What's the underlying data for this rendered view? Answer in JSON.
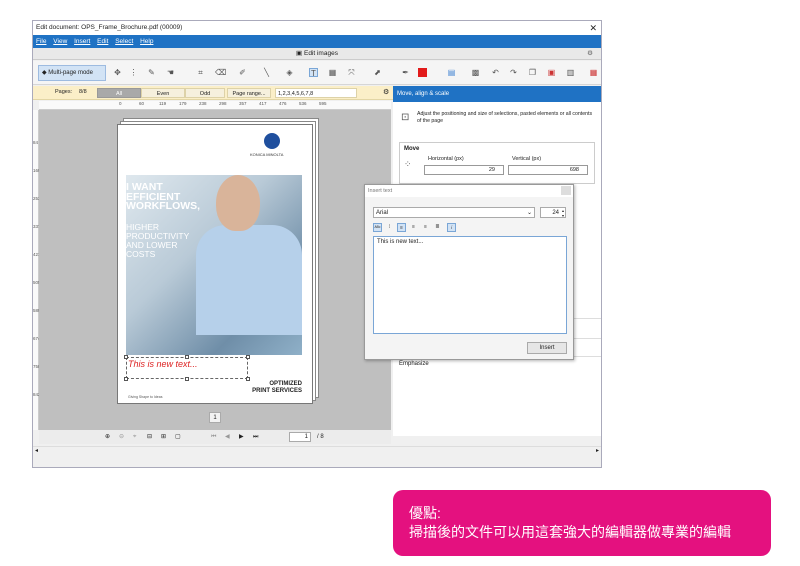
{
  "window": {
    "title": "Edit document: OPS_Frame_Brochure.pdf (00009)",
    "close": "✕"
  },
  "menu": [
    "File",
    "View",
    "Insert",
    "Edit",
    "Select",
    "Help"
  ],
  "ribbon": {
    "title": "Edit images"
  },
  "toolbar": {
    "multipage_label": "Multi-page mode"
  },
  "pages_bar": {
    "label": "Pages:",
    "count": "8/8",
    "all": "All",
    "even": "Even",
    "odd": "Odd",
    "range": "Page range...",
    "range_value": "1,2,3,4,5,6,7,8"
  },
  "ruler": {
    "h_ticks": [
      "0",
      "60",
      "119",
      "179",
      "238",
      "298",
      "357",
      "417",
      "476",
      "536",
      "595"
    ],
    "v_ticks": [
      "84",
      "169",
      "253",
      "337",
      "421",
      "505",
      "589",
      "674",
      "758",
      "842"
    ]
  },
  "brochure": {
    "logo_text": "KONICA MINOLTA",
    "headline": [
      "I WANT",
      "EFFICIENT",
      "WORKFLOWS,"
    ],
    "subline": [
      "HIGHER",
      "PRODUCTIVITY",
      "AND LOWER",
      "COSTS"
    ],
    "new_text": "This is new text...",
    "footer_left": "Giving Shape to Ideas",
    "footer_right": [
      "OPTIMIZED",
      "PRINT SERVICES"
    ]
  },
  "canvas": {
    "page_badge": "1"
  },
  "navigation": {
    "current_page": "1",
    "total": "/ 8"
  },
  "right_panel": {
    "header": "Move, align & scale",
    "description": "Adjust the positioning and size of selections, pasted elements or all contents of the page",
    "move_label": "Move",
    "horizontal_label": "Horizontal (px)",
    "horizontal_value": "29",
    "vertical_label": "Vertical (px)",
    "vertical_value": "698",
    "emphasize": "Emphasize"
  },
  "insert_dialog": {
    "title": "Insert text",
    "font": "Arial",
    "size": "24",
    "text": "This is new text...",
    "insert_button": "Insert"
  },
  "callout": {
    "title": "優點:",
    "body": "掃描後的文件可以用這套強大的編輯器做專業的編輯"
  },
  "colors": {
    "accent": "#1f72c4",
    "callout": "#e4117f",
    "new_text": "#d22222",
    "pages_bar": "#fbefc8"
  }
}
